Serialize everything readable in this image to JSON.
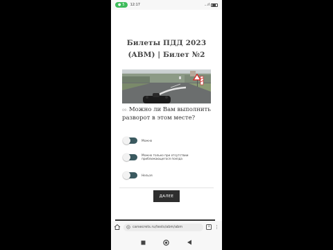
{
  "status_bar": {
    "record_indicator": "5",
    "time": "12:17",
    "signal_text": "...ıl",
    "battery_icon": "battery-icon"
  },
  "page": {
    "title": "Билеты ПДД 2023 (ABM) | Билет №2"
  },
  "question": {
    "number": "09.",
    "text": "Можно ли Вам выполнить разворот в этом месте?"
  },
  "options": [
    {
      "label": "Можно"
    },
    {
      "label": "Можно только при отсутствии приближающегося поезда"
    },
    {
      "label": "Нельзя"
    }
  ],
  "next_button": {
    "label": "ДАЛЕЕ"
  },
  "browser": {
    "url": "carsecrets.ru/tests/abm/abm",
    "tab_count": "1",
    "menu_icon": "⋮"
  },
  "colors": {
    "toggle_track": "#3b5a60",
    "button_bg": "#2e2e2e",
    "record_pill": "#3dbb5a"
  }
}
